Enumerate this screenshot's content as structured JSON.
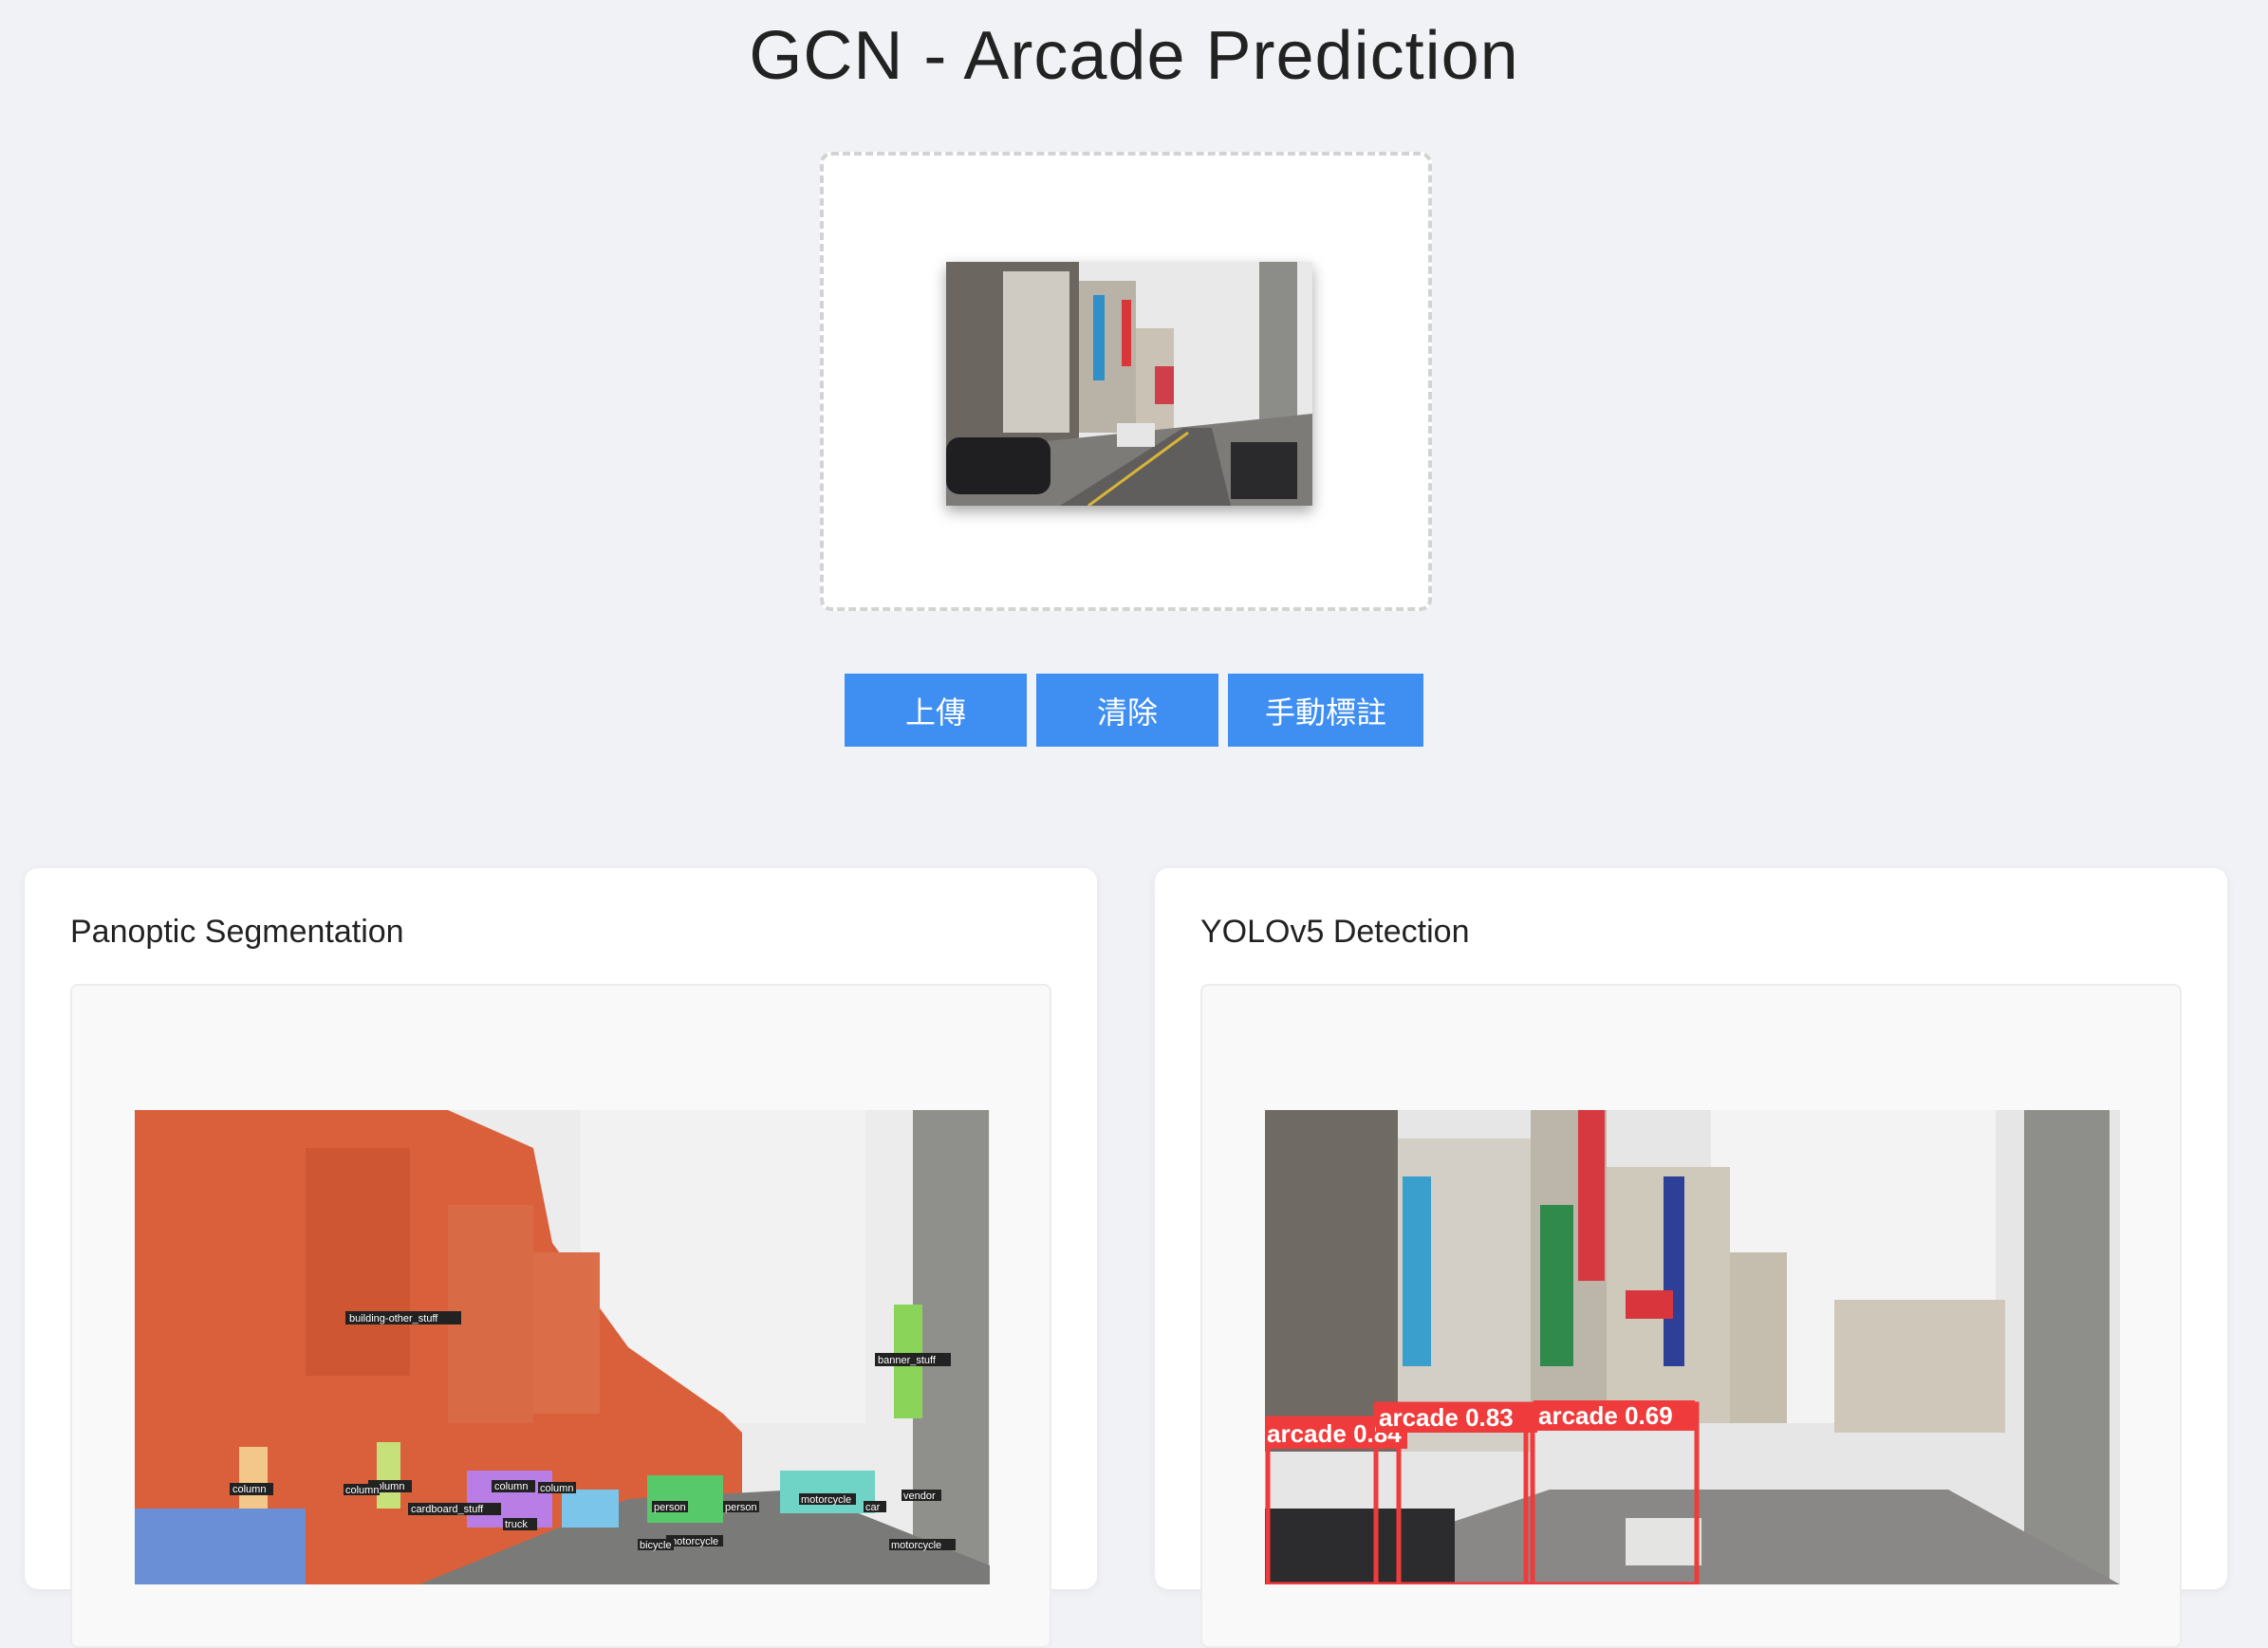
{
  "page": {
    "title": "GCN - Arcade Prediction"
  },
  "upload": {
    "preview_icon": "street-photo-thumbnail"
  },
  "buttons": {
    "upload_label": "上傳",
    "clear_label": "清除",
    "annotate_label": "手動標註"
  },
  "panels": {
    "segmentation": {
      "title": "Panoptic Segmentation",
      "labels": {
        "building": "building-other_stuff",
        "banner": "banner_stuff",
        "column1": "column",
        "column2": "column",
        "column3": "column",
        "column4": "column",
        "column5": "column",
        "cardboard": "cardboard_stuff",
        "truck": "truck",
        "person1": "person",
        "person2": "person",
        "motorcycle1": "motorcycle",
        "motorcycle2": "motorcycle",
        "motorcycle3": "motorcycle",
        "car": "car",
        "vendor": "vendor",
        "bicycle": "bicycle"
      }
    },
    "detection": {
      "title": "YOLOv5 Detection",
      "labels": {
        "box1": "arcade 0.84",
        "box2": "arcade 0.83",
        "box3": "arcade 0.69"
      }
    }
  },
  "colors": {
    "button_bg": "#3f8ef2",
    "background": "#f1f2f6",
    "detection_box": "#ef3b3b",
    "segmentation_building": "#d9603b"
  }
}
